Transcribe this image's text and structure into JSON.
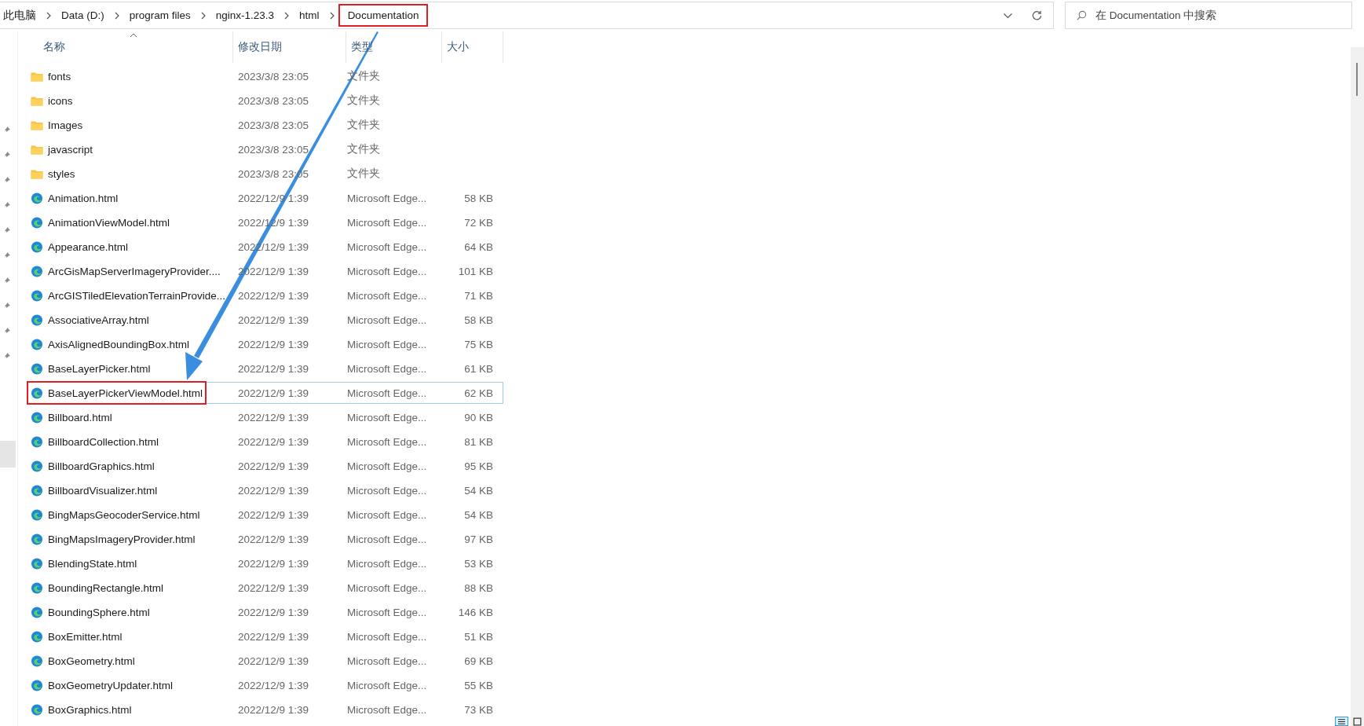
{
  "address_bar": {
    "breadcrumbs": [
      {
        "label": "此电脑",
        "highlighted": false
      },
      {
        "label": "Data (D:)",
        "highlighted": false
      },
      {
        "label": "program files",
        "highlighted": false
      },
      {
        "label": "nginx-1.23.3",
        "highlighted": false
      },
      {
        "label": "html",
        "highlighted": false
      },
      {
        "label": "Documentation",
        "highlighted": true
      }
    ]
  },
  "search": {
    "placeholder": "在 Documentation 中搜索"
  },
  "table": {
    "columns": [
      "名称",
      "修改日期",
      "类型",
      "大小"
    ],
    "rows": [
      {
        "kind": "folder",
        "name": "fonts",
        "date": "2023/3/8 23:05",
        "type": "文件夹",
        "selected": false,
        "highlighted": false
      },
      {
        "kind": "folder",
        "name": "icons",
        "date": "2023/3/8 23:05",
        "type": "文件夹",
        "selected": false,
        "highlighted": false
      },
      {
        "kind": "folder",
        "name": "Images",
        "date": "2023/3/8 23:05",
        "type": "文件夹",
        "selected": false,
        "highlighted": false
      },
      {
        "kind": "folder",
        "name": "javascript",
        "date": "2023/3/8 23:05",
        "type": "文件夹",
        "selected": false,
        "highlighted": false
      },
      {
        "kind": "folder",
        "name": "styles",
        "date": "2023/3/8 23:05",
        "type": "文件夹",
        "selected": false,
        "highlighted": false
      },
      {
        "kind": "html",
        "name": "Animation.html",
        "date": "2022/12/9 1:39",
        "type": "Microsoft Edge...",
        "size": "58 KB",
        "selected": false,
        "highlighted": false
      },
      {
        "kind": "html",
        "name": "AnimationViewModel.html",
        "date": "2022/12/9 1:39",
        "type": "Microsoft Edge...",
        "size": "72 KB",
        "selected": false,
        "highlighted": false
      },
      {
        "kind": "html",
        "name": "Appearance.html",
        "date": "2022/12/9 1:39",
        "type": "Microsoft Edge...",
        "size": "64 KB",
        "selected": false,
        "highlighted": false
      },
      {
        "kind": "html",
        "name": "ArcGisMapServerImageryProvider....",
        "date": "2022/12/9 1:39",
        "type": "Microsoft Edge...",
        "size": "101 KB",
        "selected": false,
        "highlighted": false
      },
      {
        "kind": "html",
        "name": "ArcGISTiledElevationTerrainProvide...",
        "date": "2022/12/9 1:39",
        "type": "Microsoft Edge...",
        "size": "71 KB",
        "selected": false,
        "highlighted": false
      },
      {
        "kind": "html",
        "name": "AssociativeArray.html",
        "date": "2022/12/9 1:39",
        "type": "Microsoft Edge...",
        "size": "58 KB",
        "selected": false,
        "highlighted": false
      },
      {
        "kind": "html",
        "name": "AxisAlignedBoundingBox.html",
        "date": "2022/12/9 1:39",
        "type": "Microsoft Edge...",
        "size": "75 KB",
        "selected": false,
        "highlighted": false
      },
      {
        "kind": "html",
        "name": "BaseLayerPicker.html",
        "date": "2022/12/9 1:39",
        "type": "Microsoft Edge...",
        "size": "61 KB",
        "selected": false,
        "highlighted": false
      },
      {
        "kind": "html",
        "name": "BaseLayerPickerViewModel.html",
        "date": "2022/12/9 1:39",
        "type": "Microsoft Edge...",
        "size": "62 KB",
        "selected": true,
        "highlighted": true
      },
      {
        "kind": "html",
        "name": "Billboard.html",
        "date": "2022/12/9 1:39",
        "type": "Microsoft Edge...",
        "size": "90 KB",
        "selected": false,
        "highlighted": false
      },
      {
        "kind": "html",
        "name": "BillboardCollection.html",
        "date": "2022/12/9 1:39",
        "type": "Microsoft Edge...",
        "size": "81 KB",
        "selected": false,
        "highlighted": false
      },
      {
        "kind": "html",
        "name": "BillboardGraphics.html",
        "date": "2022/12/9 1:39",
        "type": "Microsoft Edge...",
        "size": "95 KB",
        "selected": false,
        "highlighted": false
      },
      {
        "kind": "html",
        "name": "BillboardVisualizer.html",
        "date": "2022/12/9 1:39",
        "type": "Microsoft Edge...",
        "size": "54 KB",
        "selected": false,
        "highlighted": false
      },
      {
        "kind": "html",
        "name": "BingMapsGeocoderService.html",
        "date": "2022/12/9 1:39",
        "type": "Microsoft Edge...",
        "size": "54 KB",
        "selected": false,
        "highlighted": false
      },
      {
        "kind": "html",
        "name": "BingMapsImageryProvider.html",
        "date": "2022/12/9 1:39",
        "type": "Microsoft Edge...",
        "size": "97 KB",
        "selected": false,
        "highlighted": false
      },
      {
        "kind": "html",
        "name": "BlendingState.html",
        "date": "2022/12/9 1:39",
        "type": "Microsoft Edge...",
        "size": "53 KB",
        "selected": false,
        "highlighted": false
      },
      {
        "kind": "html",
        "name": "BoundingRectangle.html",
        "date": "2022/12/9 1:39",
        "type": "Microsoft Edge...",
        "size": "88 KB",
        "selected": false,
        "highlighted": false
      },
      {
        "kind": "html",
        "name": "BoundingSphere.html",
        "date": "2022/12/9 1:39",
        "type": "Microsoft Edge...",
        "size": "146 KB",
        "selected": false,
        "highlighted": false
      },
      {
        "kind": "html",
        "name": "BoxEmitter.html",
        "date": "2022/12/9 1:39",
        "type": "Microsoft Edge...",
        "size": "51 KB",
        "selected": false,
        "highlighted": false
      },
      {
        "kind": "html",
        "name": "BoxGeometry.html",
        "date": "2022/12/9 1:39",
        "type": "Microsoft Edge...",
        "size": "69 KB",
        "selected": false,
        "highlighted": false
      },
      {
        "kind": "html",
        "name": "BoxGeometryUpdater.html",
        "date": "2022/12/9 1:39",
        "type": "Microsoft Edge...",
        "size": "55 KB",
        "selected": false,
        "highlighted": false
      },
      {
        "kind": "html",
        "name": "BoxGraphics.html",
        "date": "2022/12/9 1:39",
        "type": "Microsoft Edge...",
        "size": "73 KB",
        "selected": false,
        "highlighted": false
      }
    ]
  },
  "view_buttons": [
    {
      "kind": "details",
      "selected": true
    },
    {
      "kind": "tiles",
      "selected": false
    }
  ]
}
